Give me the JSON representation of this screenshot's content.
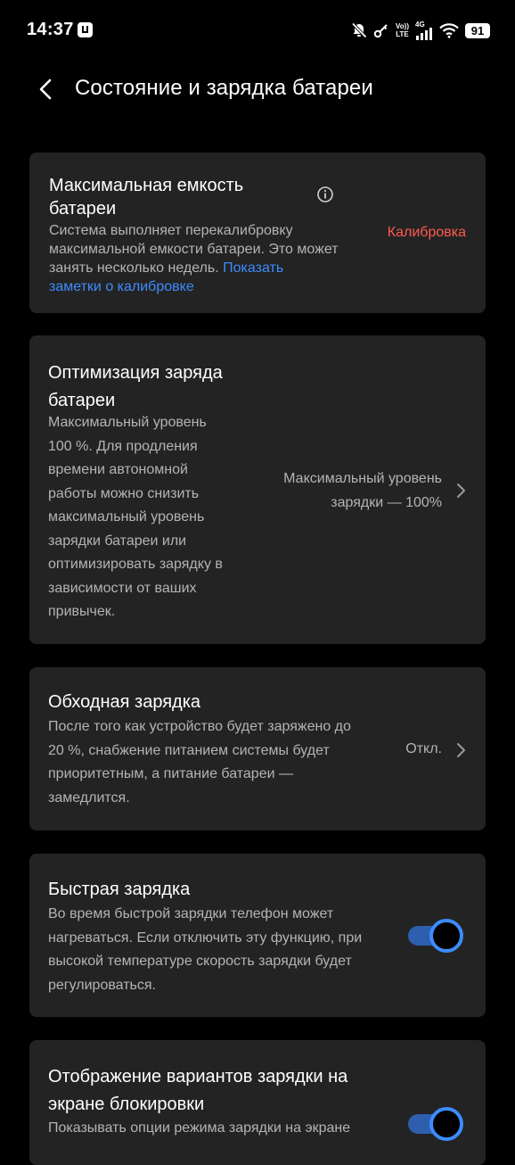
{
  "status_bar": {
    "time": "14:37",
    "volte_top": "Vo))",
    "volte_bottom": "LTE",
    "network": "4G",
    "battery": "91"
  },
  "header": {
    "title": "Состояние и зарядка батареи"
  },
  "cards": {
    "capacity": {
      "title_line1": "Максимальная емкость",
      "title_line2": "батареи",
      "desc_line1": "Система выполняет перекалибровку",
      "desc_line2": "максимальной емкости батареи. Это может",
      "desc_line3a": "занять несколько недель.",
      "desc_link_a": "Показать",
      "desc_link_b": "заметки о калибровке",
      "status": "Калибровка"
    },
    "optimization": {
      "title_line1": "Оптимизация заряда",
      "title_line2": "батареи",
      "desc_lines": [
        "Максимальный уровень",
        "100 %. Для продления",
        "времени автономной",
        "работы можно снизить",
        "максимальный уровень",
        "зарядки батареи или",
        "оптимизировать зарядку в",
        "зависимости от ваших",
        "привычек."
      ],
      "value_line1": "Максимальный уровень",
      "value_line2": "зарядки — 100%"
    },
    "bypass": {
      "title": "Обходная зарядка",
      "desc_lines": [
        "После того как устройство будет заряжено до",
        "20 %, снабжение питанием системы будет",
        "приоритетным, а питание батареи —",
        "замедлится."
      ],
      "value": "Откл."
    },
    "fast": {
      "title": "Быстрая зарядка",
      "desc_lines": [
        "Во время быстрой зарядки телефон может",
        "нагреваться. Если отключить эту функцию, при",
        "высокой температуре скорость зарядки будет",
        "регулироваться."
      ],
      "enabled": true
    },
    "lockscreen": {
      "title_line1": "Отображение вариантов зарядки на",
      "title_line2": "экране блокировки",
      "desc_line1": "Показывать опции режима зарядки на экране",
      "enabled": true
    }
  },
  "colors": {
    "background": "#000000",
    "card": "#232323",
    "accent": "#3d8bfd",
    "warning": "#ff5a4d",
    "secondary_text": "#b4b4b4"
  }
}
